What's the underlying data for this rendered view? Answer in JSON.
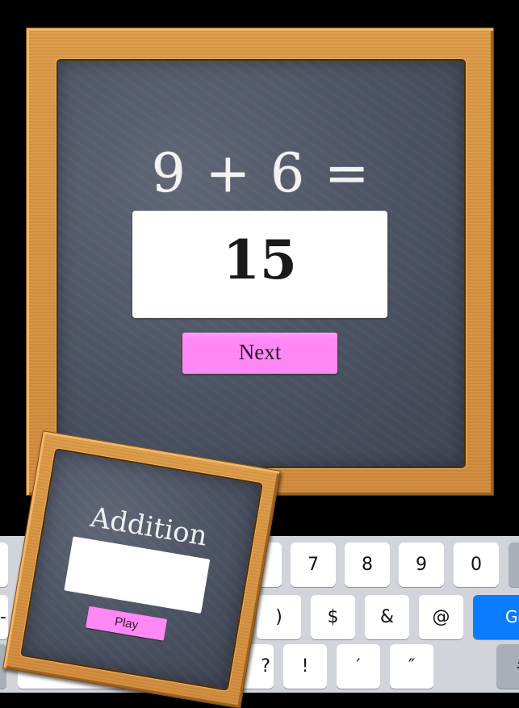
{
  "main": {
    "equation": "9 + 6 =",
    "answer_value": "15",
    "next_label": "Next"
  },
  "mini": {
    "title": "Addition",
    "input_value": "",
    "play_label": "Play"
  },
  "keyboard": {
    "row1": [
      "",
      "7",
      "8",
      "9",
      "0",
      ""
    ],
    "row2": [
      "-",
      ")",
      "$",
      "&",
      "@",
      "Go"
    ],
    "row3": [
      "?",
      "!",
      "′",
      "″",
      "#+="
    ],
    "accent_color": "#0a7cff",
    "button_color": "#ff88f5"
  }
}
